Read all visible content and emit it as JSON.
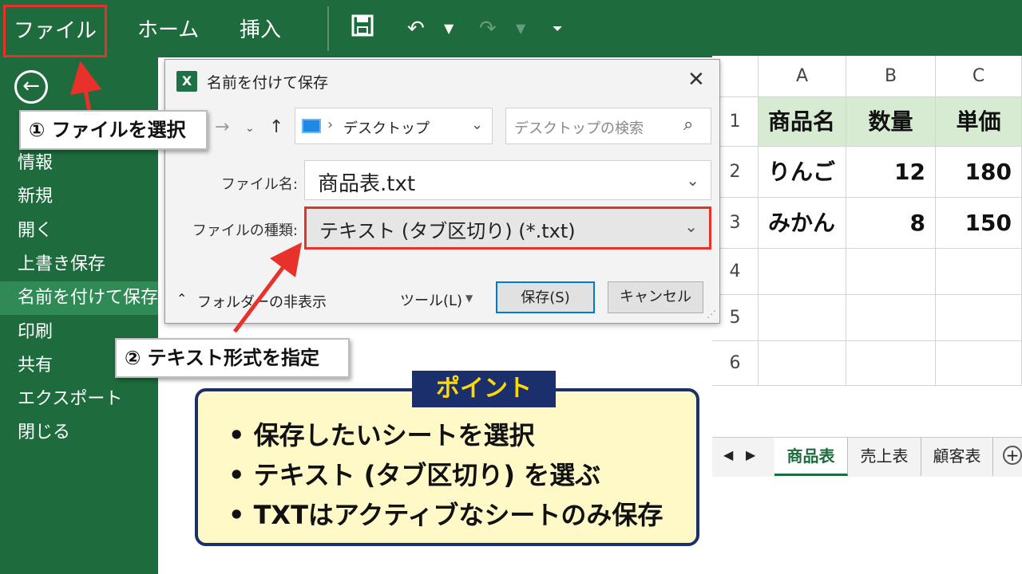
{
  "ribbon": {
    "tabs": [
      "ファイル",
      "ホーム",
      "挿入"
    ],
    "save_icon": "save-icon",
    "undo_icon": "undo-icon",
    "redo_icon": "redo-icon"
  },
  "sidebar": {
    "back_icon": "back-arrow-icon",
    "items": [
      "情報",
      "新規",
      "開く",
      "上書き保存",
      "名前を付けて保存",
      "印刷",
      "共有",
      "エクスポート",
      "閉じる"
    ],
    "active_index": 4
  },
  "callouts": {
    "step1": "① ファイルを選択",
    "step2": "② テキスト形式を指定"
  },
  "dialog": {
    "title": "名前を付けて保存",
    "location": "デスクトップ",
    "search_placeholder": "デスクトップの検索",
    "filename_label": "ファイル名:",
    "filename_value": "商品表.txt",
    "filetype_label": "ファイルの種類:",
    "filetype_value": "テキスト (タブ区切り) (*.txt)",
    "hide_folders": "フォルダーの非表示",
    "tools": "ツール(L)",
    "save_button": "保存(S)",
    "cancel_button": "キャンセル",
    "accent_color": "#e8312b"
  },
  "spreadsheet": {
    "columns": [
      "A",
      "B",
      "C"
    ],
    "row_numbers": [
      "1",
      "2",
      "3",
      "4",
      "5",
      "6"
    ],
    "rows": [
      [
        "商品名",
        "数量",
        "単価"
      ],
      [
        "りんご",
        "12",
        "180"
      ],
      [
        "みかん",
        "8",
        "150"
      ]
    ],
    "sheet_tabs": [
      "商品表",
      "売上表",
      "顧客表"
    ],
    "active_sheet": 0
  },
  "point": {
    "label": "ポイント",
    "lines": [
      "• 保存したいシートを選択",
      "• テキスト (タブ区切り) を選ぶ",
      "• TXTはアクティブなシートのみ保存"
    ]
  },
  "colors": {
    "excel_green": "#1e6b3d",
    "highlight_red": "#e8312b",
    "point_navy": "#1a2f6b",
    "point_yellow": "#ffd900",
    "header_cell": "#d6ebd2"
  }
}
